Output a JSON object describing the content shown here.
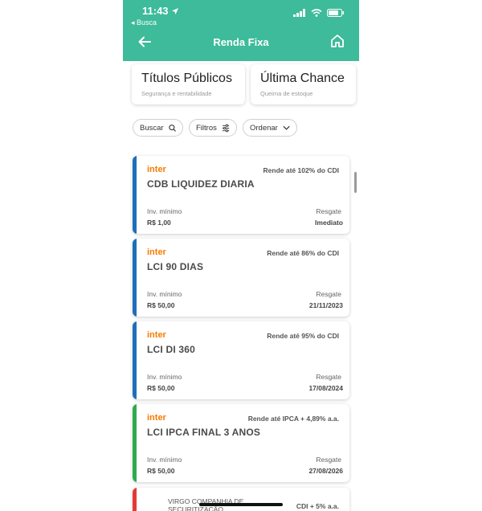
{
  "status_bar": {
    "time": "11:43",
    "back_app": "◂ Busca"
  },
  "header": {
    "title": "Renda Fixa"
  },
  "categories": [
    {
      "title": "Títulos Públicos",
      "subtitle": "Segurança e rentabilidade"
    },
    {
      "title": "Última Chance",
      "subtitle": "Queima de estoque"
    }
  ],
  "filters": {
    "search": "Buscar",
    "filters": "Filtros",
    "sort": "Ordenar"
  },
  "labels": {
    "min_investment": "Inv. mínimo",
    "redemption": "Resgate"
  },
  "products": [
    {
      "issuer": "inter",
      "rate": "Rende até 102% do CDI",
      "name": "CDB LIQUIDEZ DIARIA",
      "min": "R$ 1,00",
      "redemption": "Imediato",
      "color": "#1e6fba"
    },
    {
      "issuer": "inter",
      "rate": "Rende até 86% do CDI",
      "name": "LCI 90 DIAS",
      "min": "R$ 50,00",
      "redemption": "21/11/2023",
      "color": "#1e6fba"
    },
    {
      "issuer": "inter",
      "rate": "Rende até 95% do CDI",
      "name": "LCI DI 360",
      "min": "R$ 50,00",
      "redemption": "17/08/2024",
      "color": "#1e6fba"
    },
    {
      "issuer": "inter",
      "rate": "Rende até IPCA + 4,89% a.a.",
      "name": "LCI IPCA FINAL 3 ANOS",
      "min": "R$ 50,00",
      "redemption": "27/08/2026",
      "color": "#2eab4f"
    }
  ],
  "partial_product": {
    "issuer": "VIRGO COMPANHIA DE SECURITIZAÇÃO",
    "rate": "CDI + 5% a.a.",
    "color": "#e53935"
  }
}
